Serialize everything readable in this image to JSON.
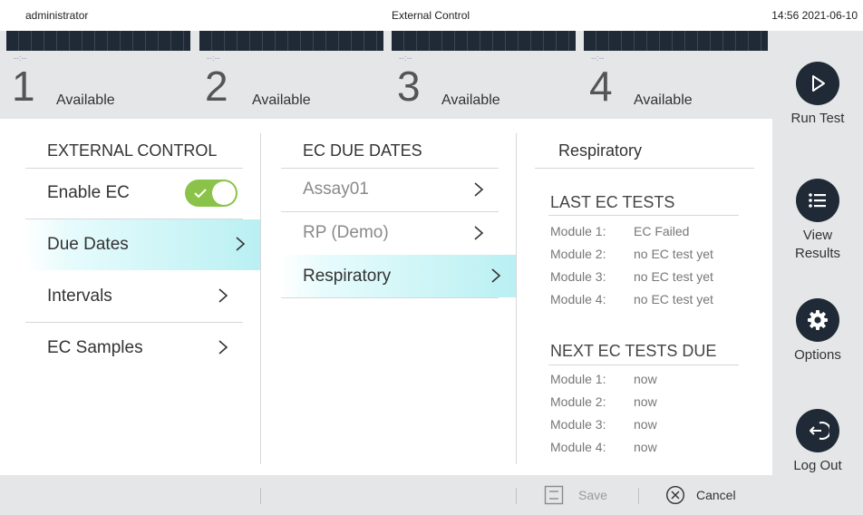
{
  "topbar": {
    "user": "administrator",
    "title": "External Control",
    "clock": "14:56 2021-06-10"
  },
  "modules": [
    {
      "time": "--:--",
      "number": "1",
      "status": "Available"
    },
    {
      "time": "--:--",
      "number": "2",
      "status": "Available"
    },
    {
      "time": "--:--",
      "number": "3",
      "status": "Available"
    },
    {
      "time": "--:--",
      "number": "4",
      "status": "Available"
    }
  ],
  "sidebar": {
    "run_test": "Run Test",
    "view_results": "View Results",
    "options": "Options",
    "log_out": "Log Out"
  },
  "external_control": {
    "heading": "EXTERNAL CONTROL",
    "enable_ec": "Enable EC",
    "enable_ec_on": true,
    "due_dates": "Due Dates",
    "intervals": "Intervals",
    "ec_samples": "EC Samples"
  },
  "ec_due_dates": {
    "heading": "EC DUE DATES",
    "items": [
      "Assay01",
      "RP (Demo)",
      "Respiratory"
    ]
  },
  "respiratory": {
    "heading": "Respiratory",
    "last_heading": "LAST EC TESTS",
    "last": [
      {
        "module": "Module 1:",
        "value": "EC Failed"
      },
      {
        "module": "Module 2:",
        "value": "no EC test yet"
      },
      {
        "module": "Module 3:",
        "value": "no EC test yet"
      },
      {
        "module": "Module 4:",
        "value": "no EC test yet"
      }
    ],
    "next_heading": "NEXT EC TESTS DUE",
    "next": [
      {
        "module": "Module 1:",
        "value": "now"
      },
      {
        "module": "Module 2:",
        "value": "now"
      },
      {
        "module": "Module 3:",
        "value": "now"
      },
      {
        "module": "Module 4:",
        "value": "now"
      }
    ]
  },
  "bottombar": {
    "save": "Save",
    "cancel": "Cancel"
  },
  "colors": {
    "dark": "#1f2a36",
    "toggle_on": "#8bc34a",
    "selected": "#b9f0f3",
    "panel": "#e5e6e7"
  }
}
